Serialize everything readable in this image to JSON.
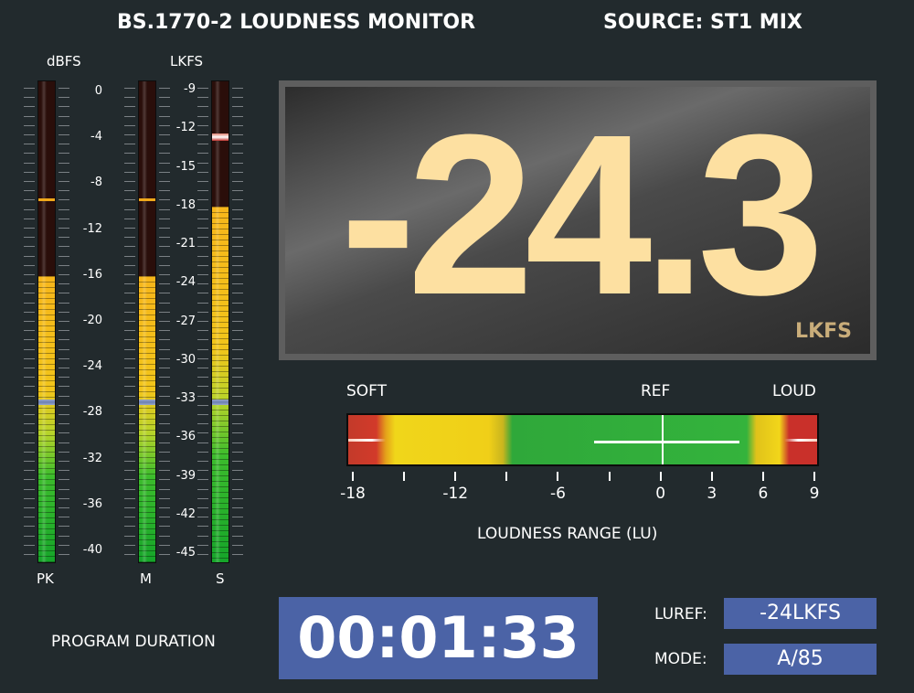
{
  "header": {
    "title": "BS.1770-2 LOUDNESS MONITOR",
    "source": "SOURCE: ST1 MIX"
  },
  "meters": {
    "dbfs_label": "dBFS",
    "lkfs_label": "LKFS",
    "dbfs_scale": [
      "0",
      "-4",
      "-8",
      "-12",
      "-16",
      "-20",
      "-24",
      "-28",
      "-32",
      "-36",
      "-40"
    ],
    "lkfs_scale": [
      "-9",
      "-12",
      "-15",
      "-18",
      "-21",
      "-24",
      "-27",
      "-30",
      "-33",
      "-36",
      "-39",
      "-42",
      "-45"
    ],
    "pk_label": "PK",
    "m_label": "M",
    "s_label": "S",
    "pk_level_dbfs": -16,
    "pk_peak_hold_dbfs": -9.3,
    "m_level_dbfs": -16,
    "m_peak_hold_dbfs": -9.3,
    "s_level_lkfs": -18,
    "s_peak_hold_lkfs": -12.4
  },
  "display": {
    "value": "-24.3",
    "unit": "LKFS"
  },
  "loudness_range": {
    "soft_label": "SOFT",
    "ref_label": "REF",
    "loud_label": "LOUD",
    "scale": [
      "-18",
      "-12",
      "-6",
      "0",
      "3",
      "6",
      "9"
    ],
    "title": "LOUDNESS RANGE (LU)",
    "range_low_lu": -4,
    "range_high_lu": 4.5,
    "current_lu": 0
  },
  "footer": {
    "duration_label": "PROGRAM DURATION",
    "duration_value": "00:01:33",
    "luref_label": "LUREF:",
    "luref_value": "-24LKFS",
    "mode_label": "MODE:",
    "mode_value": "A/85"
  },
  "colors": {
    "background": "#222a2d",
    "display_digits": "#fde0a1",
    "box_blue": "#4b63a6"
  }
}
